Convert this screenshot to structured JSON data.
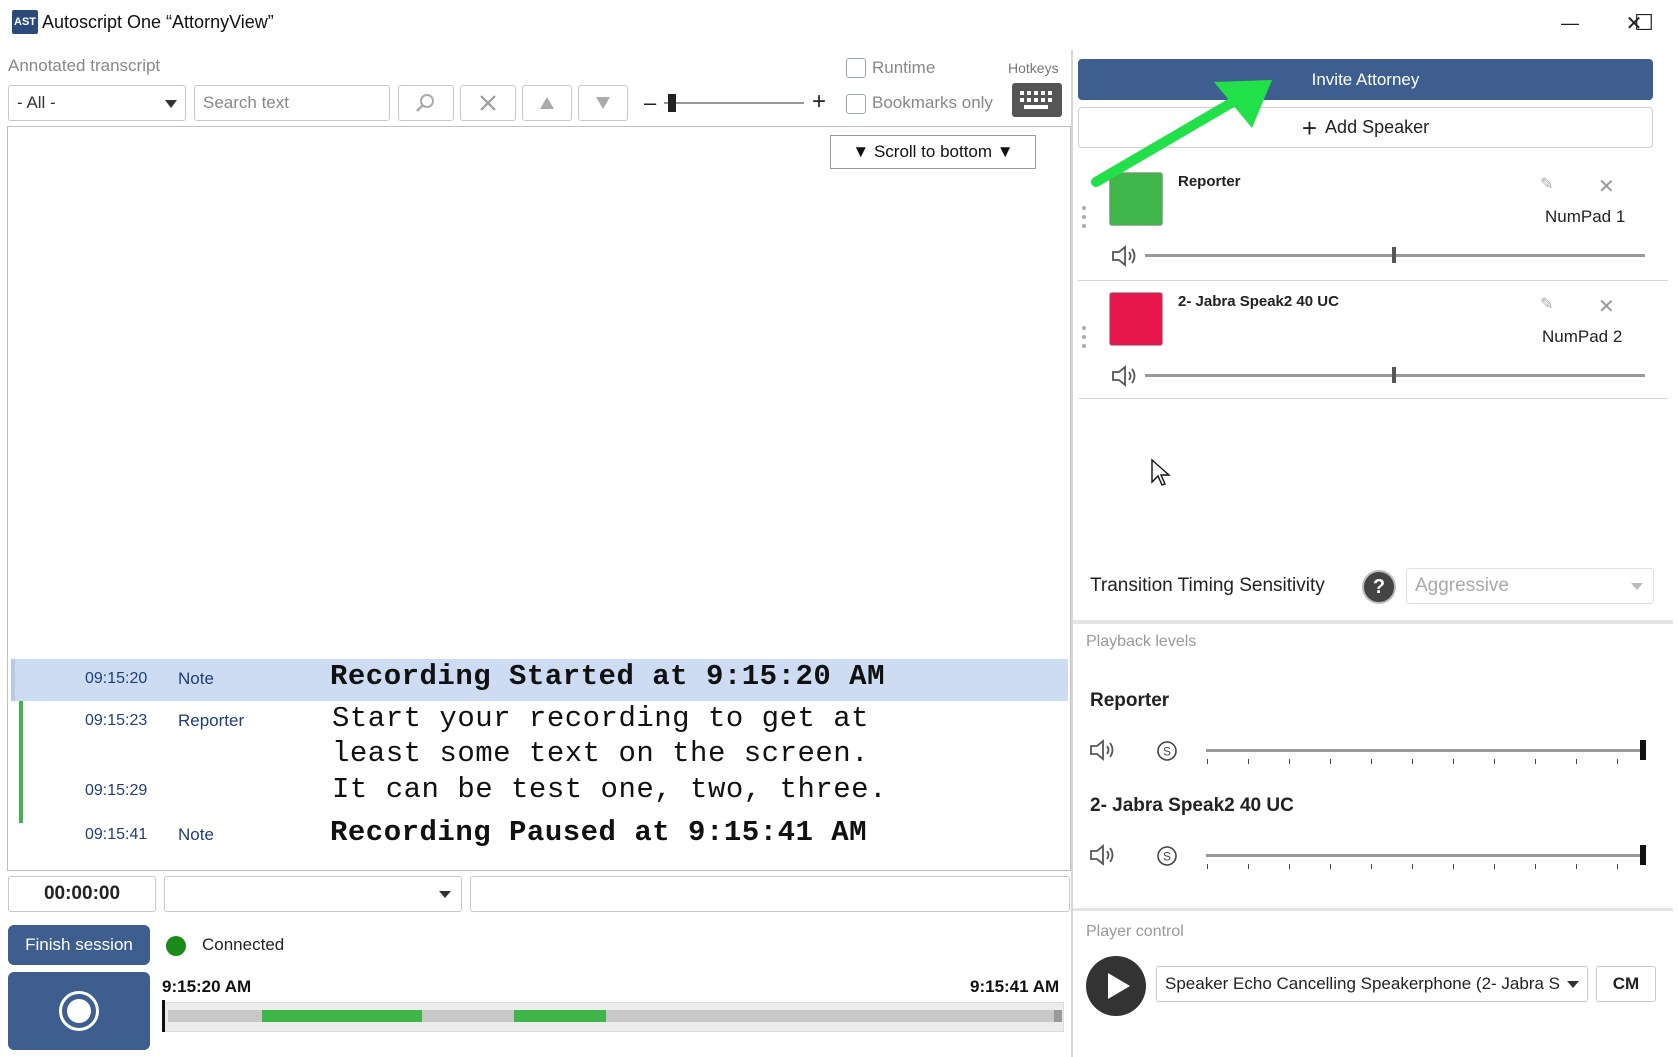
{
  "window": {
    "logo_text": "AST",
    "title": "Autoscript One “AttornyView”",
    "minimize_glyph": "—",
    "maximize_glyph": "☐",
    "close_glyph": "✕"
  },
  "toolbar": {
    "section_label": "Annotated transcript",
    "filter_value": "- All -",
    "search_placeholder": "Search text",
    "zoom_minus": "–",
    "zoom_plus": "+",
    "runtime_label": "Runtime",
    "bookmarks_label": "Bookmarks only",
    "hotkeys_label": "Hotkeys",
    "icons": [
      "search-icon",
      "clear-icon",
      "arrow-up-icon",
      "arrow-down-icon",
      "keyboard-icon"
    ]
  },
  "transcript": {
    "scroll_to_bottom_label": "▼ Scroll to bottom ▼",
    "rows": [
      {
        "time": "09:15:20",
        "speaker": "Note",
        "text": "Recording Started at 9:15:20 AM",
        "bold": true
      },
      {
        "time": "09:15:23",
        "speaker": "Reporter",
        "text_line1": "Start your recording to get at",
        "text_line2": "least some text on the screen."
      },
      {
        "time": "09:15:29",
        "speaker": "",
        "text": "It can be test one, two, three."
      },
      {
        "time": "09:15:41",
        "speaker": "Note",
        "text": "Recording Paused at 9:15:41 AM",
        "bold": true
      }
    ]
  },
  "session": {
    "elapsed": "00:00:00",
    "finish_label": "Finish session",
    "status_text": "Connected",
    "status_color": "#1a8a1a",
    "timeline_start": "9:15:20 AM",
    "timeline_end": "9:15:41 AM"
  },
  "speakers_panel": {
    "invite_label": "Invite Attorney",
    "add_speaker_label": "Add Speaker",
    "add_speaker_icon": "+",
    "speakers": [
      {
        "name": "Reporter",
        "hotkey": "NumPad 1",
        "color": "#3fb54a",
        "volume": 0.5
      },
      {
        "name": "2- Jabra Speak2 40 UC",
        "hotkey": "NumPad 2",
        "color": "#e8174b",
        "volume": 0.5
      }
    ],
    "tts_label": "Transition Timing Sensitivity",
    "tts_help": "?",
    "tts_value": "Aggressive"
  },
  "playback": {
    "section_label": "Playback levels",
    "solo_glyph": "S",
    "channels": [
      {
        "name": "Reporter",
        "level": 1.0
      },
      {
        "name": "2- Jabra Speak2 40 UC",
        "level": 1.0
      }
    ]
  },
  "player": {
    "section_label": "Player control",
    "device_value": "Speaker Echo Cancelling Speakerphone (2- Jabra S",
    "cm_label": "CM"
  },
  "colors": {
    "accent": "#3d5e8e",
    "highlight_row": "#cddcf2",
    "timeline_green": "#3fb54a",
    "annotation_arrow": "#22e04a"
  }
}
